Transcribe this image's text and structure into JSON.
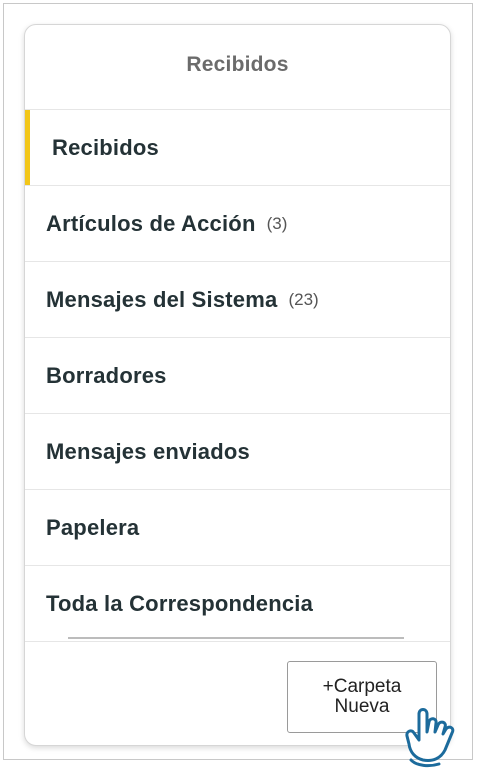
{
  "panel": {
    "title": "Recibidos"
  },
  "folders": [
    {
      "label": "Recibidos",
      "count": "",
      "active": true
    },
    {
      "label": "Artículos de Acción",
      "count": "(3)"
    },
    {
      "label": "Mensajes del Sistema",
      "count": "(23)"
    },
    {
      "label": "Borradores",
      "count": ""
    },
    {
      "label": "Mensajes enviados",
      "count": ""
    },
    {
      "label": "Papelera",
      "count": ""
    },
    {
      "label": "Toda la Correspondencia",
      "count": ""
    }
  ],
  "actions": {
    "new_folder_label": "+Carpeta Nueva"
  },
  "colors": {
    "active_indicator": "#f2c618",
    "text_primary": "#243236",
    "header_text": "#6b6b6b",
    "pointer_hand": "#1c6b9c"
  },
  "icons": {
    "pointer": "pointing-hand-icon"
  }
}
